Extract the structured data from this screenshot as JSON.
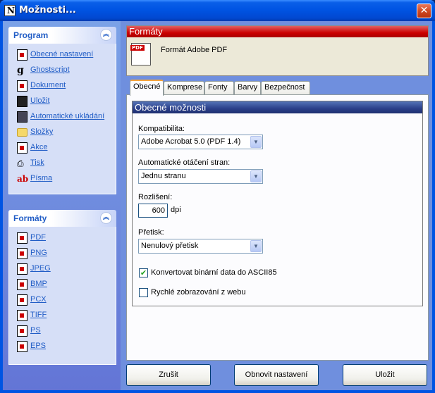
{
  "window": {
    "title": "Možnosti...",
    "close_glyph": "✕"
  },
  "sidebar": {
    "program": {
      "title": "Program",
      "items": [
        {
          "label": "Obecné nastavení",
          "icon": "general-settings-icon"
        },
        {
          "label": "Ghostscript",
          "icon": "ghostscript-icon"
        },
        {
          "label": "Dokument",
          "icon": "document-icon"
        },
        {
          "label": "Uložit",
          "icon": "save-icon"
        },
        {
          "label": "Automatické ukládání",
          "icon": "autosave-icon"
        },
        {
          "label": "Složky",
          "icon": "folder-icon"
        },
        {
          "label": "Akce",
          "icon": "actions-icon"
        },
        {
          "label": "Tisk",
          "icon": "printer-icon"
        },
        {
          "label": "Písma",
          "icon": "fonts-icon"
        }
      ]
    },
    "formats": {
      "title": "Formáty",
      "items": [
        {
          "label": "PDF"
        },
        {
          "label": "PNG"
        },
        {
          "label": "JPEG"
        },
        {
          "label": "BMP"
        },
        {
          "label": "PCX"
        },
        {
          "label": "TIFF"
        },
        {
          "label": "PS"
        },
        {
          "label": "EPS"
        }
      ]
    }
  },
  "format_header": {
    "title": "Formáty",
    "name": "Formát Adobe PDF"
  },
  "tabs": [
    "Obecné",
    "Komprese",
    "Fonty",
    "Barvy",
    "Bezpečnost"
  ],
  "general": {
    "title": "Obecné možnosti",
    "compatibility": {
      "label": "Kompatibilita:",
      "value": "Adobe Acrobat 5.0 (PDF 1.4)"
    },
    "auto_rotate": {
      "label": "Automatické otáčení stran:",
      "value": "Jednu stranu"
    },
    "resolution": {
      "label": "Rozlišení:",
      "value": "600",
      "unit": "dpi"
    },
    "overprint": {
      "label": "Přetisk:",
      "value": "Nenulový přetisk"
    },
    "convert_ascii85": {
      "label": "Konvertovat binární data do ASCII85",
      "checked": true
    },
    "fast_web_view": {
      "label": "Rychlé zobrazování z webu",
      "checked": false
    }
  },
  "buttons": {
    "cancel": "Zrušit",
    "reset": "Obnovit nastavení",
    "save": "Uložit"
  },
  "colors": {
    "title_bar": "#0054e3",
    "format_bar": "#cc0000",
    "group_bar": "#2b3f8a",
    "link": "#215dc6"
  }
}
